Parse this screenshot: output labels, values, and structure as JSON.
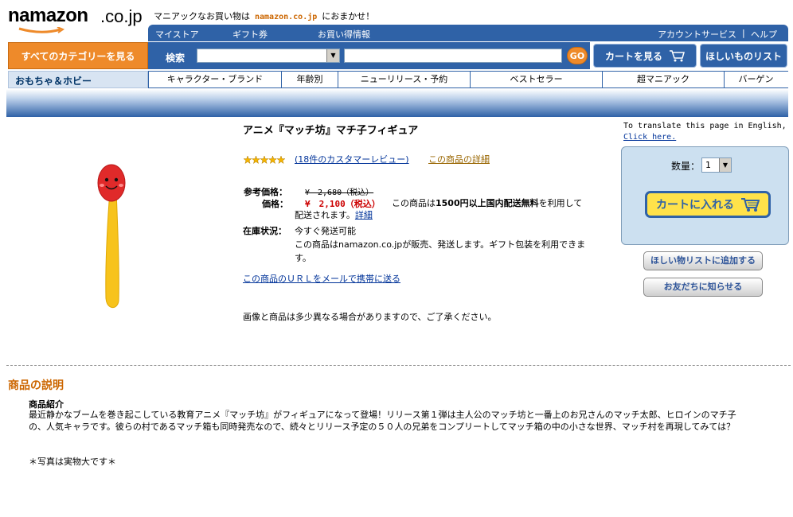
{
  "header": {
    "logo_text": "namazon",
    "logo_tld": ".co.jp",
    "tagline_before": "マニアックなお買い物は",
    "tagline_site": "namazon.co.jp",
    "tagline_after": "におまかせ！"
  },
  "topnav": {
    "my_store": "マイストア",
    "gift_card": "ギフト券",
    "bargain_info": "お買い得情報",
    "account": "アカウントサービス",
    "separator": "|",
    "help": "ヘルプ"
  },
  "search": {
    "all_categories": "すべてのカテゴリーを見る",
    "label": "検索",
    "go": "GO"
  },
  "cart_button": "カートを見る",
  "wishlist_button": "ほしいものリスト",
  "store_name": "おもちゃ＆ホビー",
  "subnav": [
    "キャラクター・ブランド",
    "年齢別",
    "ニューリリース・予約",
    "ベストセラー",
    "超マニアック",
    "バーゲン"
  ],
  "product": {
    "title": "アニメ『マッチ坊』マチ子フィギュア",
    "rating_stars": 5,
    "reviews_link": "(18件のカスタマーレビュー)",
    "details_link": "この商品の詳細",
    "list_price_label": "参考価格：",
    "list_price": "¥　2,680（税込）",
    "price_label": "価格：",
    "price": "¥　2,100（税込）",
    "ship_note_pre": "この商品は",
    "ship_note_bold": "1500円以上国内配送無料",
    "ship_note_post": "を利用して配送されます。",
    "ship_detail_link": "詳細",
    "stock_label": "在庫状況：",
    "stock_status": "今すぐ発送可能",
    "stock_note": "この商品はnamazon.co.jpが販売、発送します。ギフト包装を利用できます。",
    "mail_link": "この商品のＵＲＬをメールで携帯に送る",
    "disclaimer": "画像と商品は多少異なる場合がありますので、ご了承ください。"
  },
  "translate": {
    "text": "To translate this page in English,",
    "link": "Click here."
  },
  "buybox": {
    "qty_label": "数量：",
    "qty_value": "1",
    "add_to_cart": "カートに入れる",
    "add_wishlist": "ほしい物リストに追加する",
    "tell_friend": "お友だちに知らせる"
  },
  "description": {
    "heading": "商品の説明",
    "subheading": "商品紹介",
    "body": "最近静かなブームを巻き起こしている教育アニメ『マッチ坊』がフィギュアになって登場！リリース第１弾は主人公のマッチ坊と一番上のお兄さんのマッチ太郎、ヒロインのマチ子の、人気キャラです。彼らの村であるマッチ箱も同時発売なので、続々とリリース予定の５０人の兄弟をコンプリートしてマッチ箱の中の小さな世界、マッチ村を再現してみては？",
    "note": "＊写真は実物大です＊"
  },
  "colors": {
    "nav_blue": "#2f62a7",
    "accent_orange": "#ee8a2a",
    "price_red": "#cc0000",
    "cart_yellow": "#ffe24a"
  }
}
